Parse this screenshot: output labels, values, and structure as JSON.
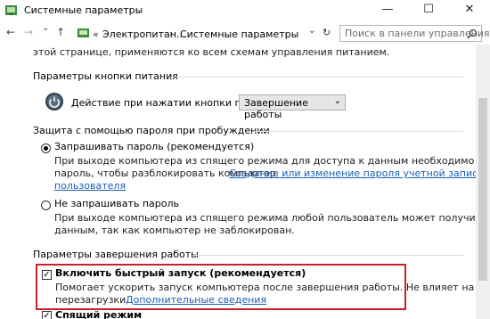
{
  "window": {
    "title": "Системные параметры",
    "minimize_glyph": "—",
    "maximize_glyph": "☐",
    "close_glyph": "✕"
  },
  "address_bar": {
    "back_glyph": "←",
    "forward_glyph": "→",
    "dropdown_glyph": "⌄",
    "up_glyph": "↑",
    "breadcrumb_overflow": "«",
    "breadcrumbs": [
      "Электропитан...",
      "Системные параметры"
    ],
    "separator": "›",
    "history_glyph": "⌄",
    "refresh_glyph": "↻",
    "search_placeholder": "Поиск в панели управления"
  },
  "content": {
    "intro_text": "этой странице, применяются ко всем схемам управления питанием.",
    "power_button_section": {
      "heading": "Параметры кнопки питания",
      "action_label": "Действие при нажатии кнопки питания:",
      "action_value": "Завершение работы"
    },
    "password_section": {
      "heading": "Защита с помощью пароля при пробуждении",
      "require_option": {
        "label": "Запрашивать пароль (рекомендуется)",
        "selected": true,
        "description_line1": "При выходе компьютера из спящего режима для доступа к данным необходимо ввести",
        "description_line2": "пароль, чтобы разблокировать компьютер.",
        "link_line1": "Создание или изменение пароля учетной записи",
        "link_line2": "пользователя"
      },
      "no_password_option": {
        "label": "Не запрашивать пароль",
        "selected": false,
        "description_line1": "При выходе компьютера из спящего режима любой пользователь может получить доступ к",
        "description_line2": "данным, так как компьютер не заблокирован."
      }
    },
    "shutdown_section": {
      "heading": "Параметры завершения работы",
      "fast_startup": {
        "label": "Включить быстрый запуск (рекомендуется)",
        "checked": true,
        "description_line1": "Помогает ускорить запуск компьютера после завершения работы. Не влияет на режим",
        "description_line2": "перезагрузки.",
        "more_link": "Дополнительные сведения"
      },
      "sleep_mode": {
        "label": "Спящий режим",
        "checked": true
      }
    }
  },
  "colors": {
    "highlight_border": "#c8202a",
    "link": "#1a5fb4"
  }
}
